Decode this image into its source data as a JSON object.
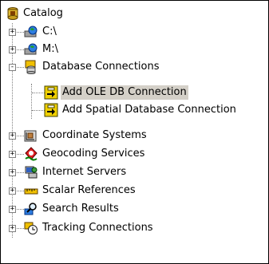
{
  "tree": {
    "root": {
      "label": "Catalog",
      "icon": "catalog-icon"
    },
    "items": [
      {
        "label": "C:\\",
        "icon": "drive-icon",
        "expander": "+"
      },
      {
        "label": "M:\\",
        "icon": "drive-icon",
        "expander": "+"
      },
      {
        "label": "Database Connections",
        "icon": "database-connections-icon",
        "expander": "-",
        "children": [
          {
            "label": "Add OLE DB Connection",
            "icon": "add-connection-icon",
            "selected": true
          },
          {
            "label": "Add Spatial Database Connection",
            "icon": "add-connection-icon"
          }
        ]
      },
      {
        "label": "Coordinate Systems",
        "icon": "coordinate-systems-icon",
        "expander": "+"
      },
      {
        "label": "Geocoding Services",
        "icon": "geocoding-services-icon",
        "expander": "+"
      },
      {
        "label": "Internet Servers",
        "icon": "internet-servers-icon",
        "expander": "+"
      },
      {
        "label": "Scalar References",
        "icon": "scalar-references-icon",
        "expander": "+"
      },
      {
        "label": "Search Results",
        "icon": "search-results-icon",
        "expander": "+"
      },
      {
        "label": "Tracking Connections",
        "icon": "tracking-connections-icon",
        "expander": "+"
      }
    ]
  }
}
